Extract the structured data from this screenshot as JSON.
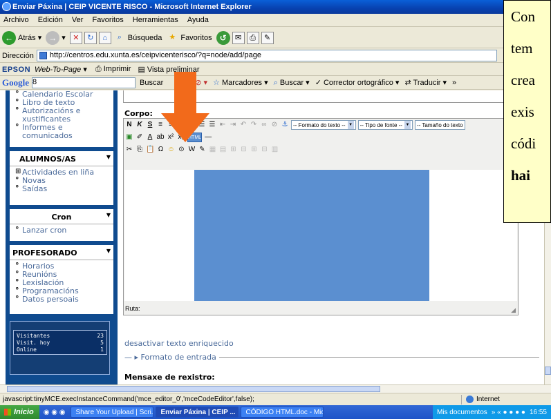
{
  "window": {
    "title": "Enviar Páxina | CEIP VICENTE RISCO - Microsoft Internet Explorer"
  },
  "menu": [
    "Archivo",
    "Edición",
    "Ver",
    "Favoritos",
    "Herramientas",
    "Ayuda"
  ],
  "toolbar": {
    "back_label": "Atrás",
    "search_label": "Búsqueda",
    "favorites_label": "Favoritos"
  },
  "address": {
    "label": "Dirección",
    "url": "http://centros.edu.xunta.es/ceipvicenterisco/?q=node/add/page"
  },
  "epson": {
    "logo": "EPSON",
    "web_to_page": "Web-To-Page",
    "print_label": "Imprimir",
    "preview_label": "Vista preliminar"
  },
  "google": {
    "logo": "Google",
    "query": "8",
    "buscar": "Buscar",
    "marcadores": "Marcadores",
    "buscar2": "Buscar",
    "spell": "Corrector ortográfico",
    "translate": "Traducir"
  },
  "sidebar": {
    "top_items": [
      "Calendario Escolar",
      "Libro de texto",
      "Autorizacións e xustificantes",
      "Informes e comunicados"
    ],
    "alumnos": {
      "title": "ALUMNOS/AS",
      "items": [
        "Actividades en liña",
        "Novas",
        "Saídas"
      ]
    },
    "cron": {
      "title": "Cron",
      "items": [
        "Lanzar cron"
      ]
    },
    "profesorado": {
      "title": "PROFESORADO",
      "items": [
        "Horarios",
        "Reunións",
        "Lexislación",
        "Programacións",
        "Datos persoais"
      ]
    },
    "visits": {
      "visitantes_label": "Visitantes",
      "visitantes_value": "23",
      "hoy_label": "Visit. hoy",
      "hoy_value": "5",
      "online_label": "Online",
      "online_value": "1"
    }
  },
  "editor": {
    "body_label": "Corpo:",
    "format_text": "-- Formato do texto --",
    "font_type": "-- Tipo de fonte --",
    "font_size": "-- Tamaño do texto",
    "path_label": "Ruta:"
  },
  "links": {
    "disable_rich": "desactivar texto enriquecido",
    "input_format": "Formato de entrada",
    "log_message": "Mensaxe de rexistro:"
  },
  "status": {
    "text": "javascript:tinyMCE.execInstanceCommand('mce_editor_0','mceCodeEditor',false);",
    "zone": "Internet"
  },
  "taskbar": {
    "start": "Inicio",
    "tasks": [
      "Share Your Upload | Scri...",
      "Enviar Páxina | CEIP ...",
      "CÓDIGO HTML.doc - Micr..."
    ],
    "my_docs": "Mis documentos",
    "clock": "16:55"
  },
  "callout": {
    "lines": [
      "Con",
      "tem",
      "crea",
      "exis",
      "códi",
      "hai"
    ]
  },
  "colors": {
    "sidebar_bg": "#0f4b8f",
    "arrow": "#f26a1b",
    "editor_blue": "#5b8fd0",
    "callout_bg": "#ffffc8"
  }
}
